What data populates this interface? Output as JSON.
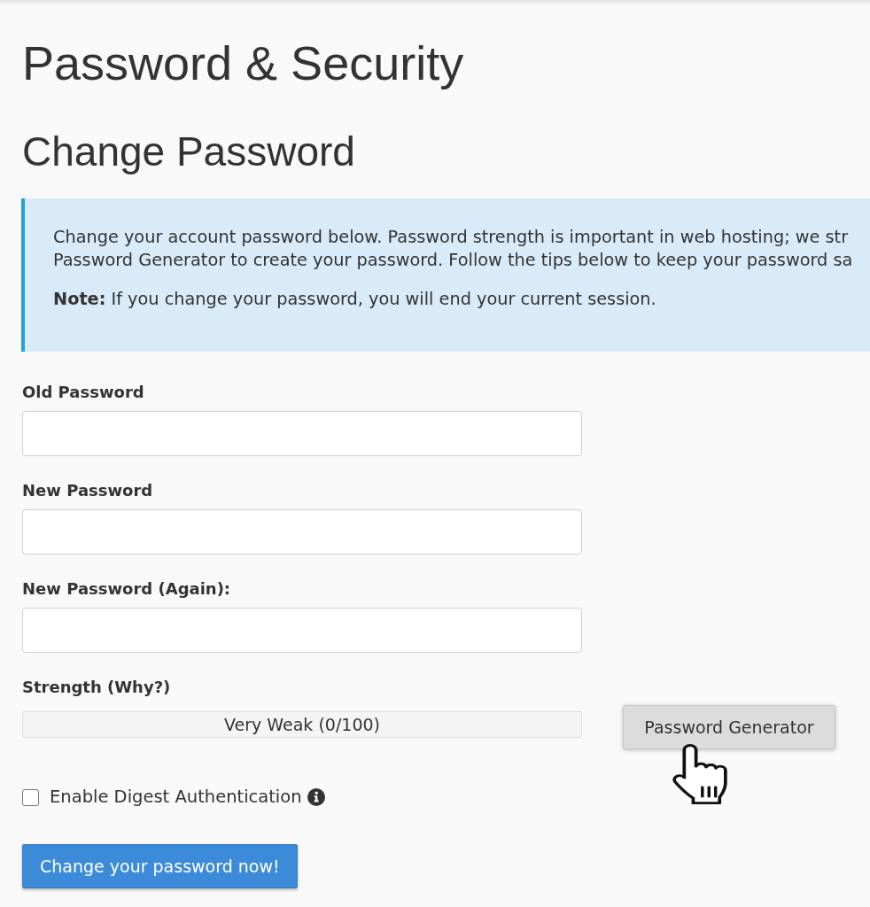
{
  "page": {
    "title": "Password & Security",
    "subtitle": "Change Password"
  },
  "notice": {
    "lines": [
      "Change your account password below. Password strength is important in web hosting; we str",
      "Password Generator to create your password. Follow the tips below to keep your password sa"
    ],
    "note": "**Note:** If you change your password, you will end your current session."
  },
  "fields": [
    {
      "label": "Old Password"
    },
    {
      "label": "New Password"
    },
    {
      "label": "New Password (Again):"
    }
  ],
  "strength": {
    "label": "Strength (Why?)",
    "level": 0,
    "reading": "Very Weak (0/100)"
  },
  "generator_button": {
    "label": "Password Generator"
  },
  "digest": {
    "label": "Enable Digest Authentication",
    "checked": false
  },
  "submit_button": {
    "label": "Change your password now!"
  }
}
